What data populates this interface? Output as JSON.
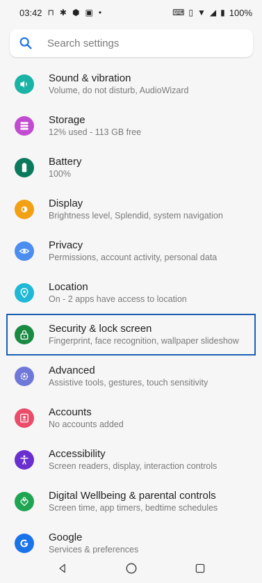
{
  "status_bar": {
    "time": "03:42",
    "battery": "100%"
  },
  "search": {
    "placeholder": "Search settings"
  },
  "items": [
    {
      "title": "Sound & vibration",
      "subtitle": "Volume, do not disturb, AudioWizard",
      "color": "#1ab3a6",
      "icon": "volume-icon"
    },
    {
      "title": "Storage",
      "subtitle": "12% used - 113 GB free",
      "color": "#c24ccf",
      "icon": "storage-icon"
    },
    {
      "title": "Battery",
      "subtitle": "100%",
      "color": "#0b7a5c",
      "icon": "battery-icon"
    },
    {
      "title": "Display",
      "subtitle": "Brightness level, Splendid, system navigation",
      "color": "#f2a114",
      "icon": "brightness-icon"
    },
    {
      "title": "Privacy",
      "subtitle": "Permissions, account activity, personal data",
      "color": "#4b8ef0",
      "icon": "eye-lock-icon"
    },
    {
      "title": "Location",
      "subtitle": "On - 2 apps have access to location",
      "color": "#20b8d6",
      "icon": "location-pin-icon"
    },
    {
      "title": "Security & lock screen",
      "subtitle": "Fingerprint, face recognition, wallpaper slideshow",
      "color": "#1a8a42",
      "icon": "lock-icon"
    },
    {
      "title": "Advanced",
      "subtitle": "Assistive tools, gestures, touch sensitivity",
      "color": "#6f78d8",
      "icon": "gear-icon"
    },
    {
      "title": "Accounts",
      "subtitle": "No accounts added",
      "color": "#ea4c6a",
      "icon": "account-icon"
    },
    {
      "title": "Accessibility",
      "subtitle": "Screen readers, display, interaction controls",
      "color": "#6a2fcf",
      "icon": "accessibility-icon"
    },
    {
      "title": "Digital Wellbeing & parental controls",
      "subtitle": "Screen time, app timers, bedtime schedules",
      "color": "#1fa552",
      "icon": "heart-icon"
    },
    {
      "title": "Google",
      "subtitle": "Services & preferences",
      "color": "#1a73e8",
      "icon": "google-icon"
    }
  ],
  "highlight_index": 6
}
